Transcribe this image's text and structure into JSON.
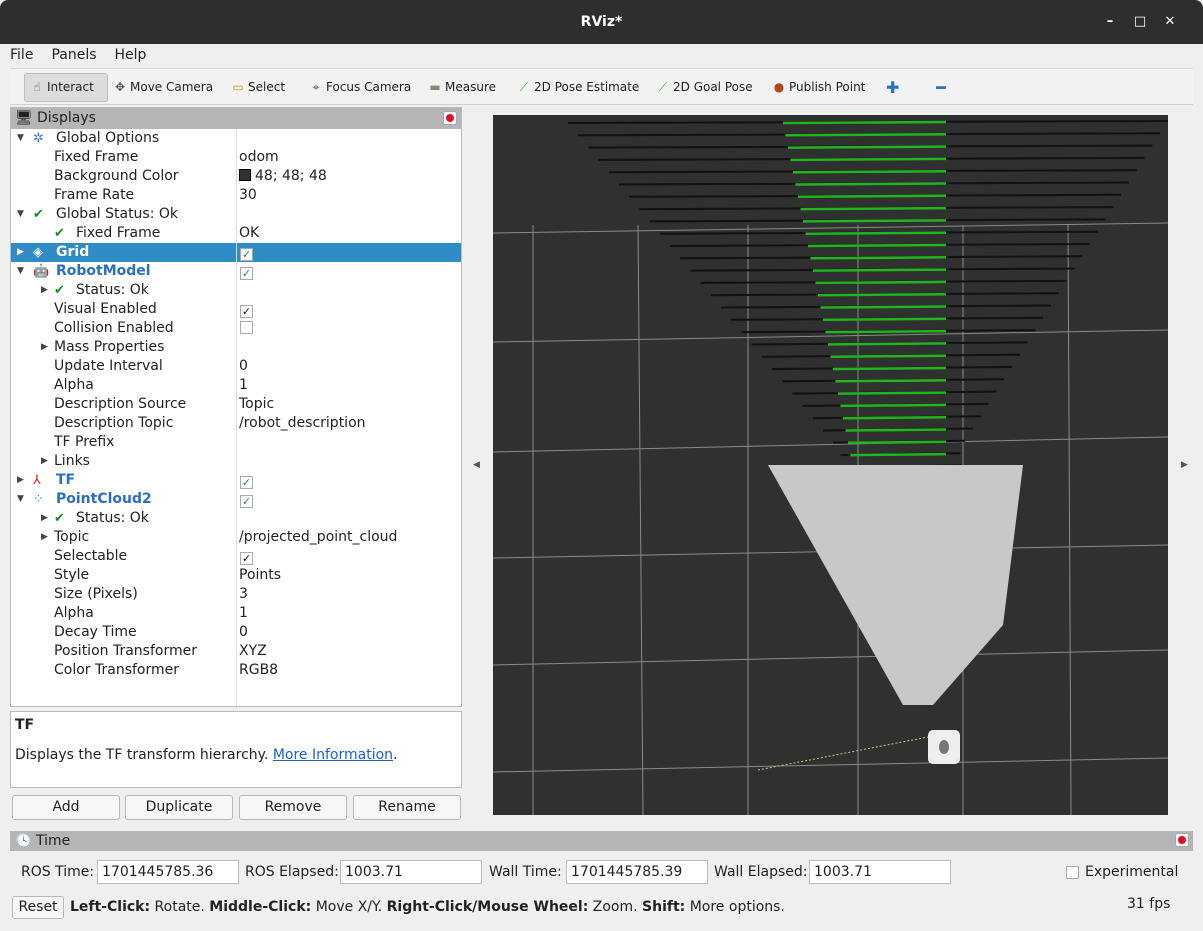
{
  "window": {
    "title": "RViz*"
  },
  "menu": [
    "File",
    "Panels",
    "Help"
  ],
  "toolbar": {
    "tools": [
      {
        "label": "Interact",
        "icon": "hand-icon",
        "active": true
      },
      {
        "label": "Move Camera",
        "icon": "move-camera-icon"
      },
      {
        "label": "Select",
        "icon": "select-icon"
      },
      {
        "label": "Focus Camera",
        "icon": "focus-camera-icon"
      },
      {
        "label": "Measure",
        "icon": "ruler-icon"
      },
      {
        "label": "2D Pose Estimate",
        "icon": "green-arrow-icon"
      },
      {
        "label": "2D Goal Pose",
        "icon": "green-arrow-icon"
      },
      {
        "label": "Publish Point",
        "icon": "map-pin-icon"
      }
    ]
  },
  "displays": {
    "title": "Displays",
    "rows": [
      {
        "label": "Global Options",
        "level": 0,
        "exp": "down",
        "icon": "gear-icon"
      },
      {
        "label": "Fixed Frame",
        "level": 1,
        "value": "odom"
      },
      {
        "label": "Background Color",
        "level": 1,
        "value": "48; 48; 48",
        "swatch": "#303030"
      },
      {
        "label": "Frame Rate",
        "level": 1,
        "value": "30"
      },
      {
        "label": "Global Status: Ok",
        "level": 0,
        "exp": "down",
        "icon": "check-icon"
      },
      {
        "label": "Fixed Frame",
        "level": 1,
        "value": "OK",
        "icon": "check-icon"
      },
      {
        "label": "Grid",
        "level": 0,
        "exp": "right",
        "icon": "grid-icon",
        "bold": true,
        "selected": true,
        "checked": true
      },
      {
        "label": "RobotModel",
        "level": 0,
        "exp": "down",
        "icon": "robot-icon",
        "bold": true,
        "checked": true
      },
      {
        "label": "Status: Ok",
        "level": 1,
        "exp": "right",
        "icon": "check-icon"
      },
      {
        "label": "Visual Enabled",
        "level": 1,
        "checked": true,
        "plain": true
      },
      {
        "label": "Collision Enabled",
        "level": 1,
        "checked": false
      },
      {
        "label": "Mass Properties",
        "level": 1,
        "exp": "right"
      },
      {
        "label": "Update Interval",
        "level": 1,
        "value": "0"
      },
      {
        "label": "Alpha",
        "level": 1,
        "value": "1"
      },
      {
        "label": "Description Source",
        "level": 1,
        "value": "Topic"
      },
      {
        "label": "Description Topic",
        "level": 1,
        "value": "/robot_description"
      },
      {
        "label": "TF Prefix",
        "level": 1
      },
      {
        "label": "Links",
        "level": 1,
        "exp": "right"
      },
      {
        "label": "TF",
        "level": 0,
        "exp": "right",
        "icon": "tf-axes-icon",
        "bold": true,
        "checked": true
      },
      {
        "label": "PointCloud2",
        "level": 0,
        "exp": "down",
        "icon": "pointcloud-icon",
        "bold": true,
        "checked": true
      },
      {
        "label": "Status: Ok",
        "level": 1,
        "exp": "right",
        "icon": "check-icon"
      },
      {
        "label": "Topic",
        "level": 1,
        "exp": "right",
        "value": "/projected_point_cloud"
      },
      {
        "label": "Selectable",
        "level": 1,
        "checked": true,
        "plain": true
      },
      {
        "label": "Style",
        "level": 1,
        "value": "Points"
      },
      {
        "label": "Size (Pixels)",
        "level": 1,
        "value": "3"
      },
      {
        "label": "Alpha",
        "level": 1,
        "value": "1"
      },
      {
        "label": "Decay Time",
        "level": 1,
        "value": "0"
      },
      {
        "label": "Position Transformer",
        "level": 1,
        "value": "XYZ"
      },
      {
        "label": "Color Transformer",
        "level": 1,
        "value": "RGB8"
      }
    ]
  },
  "description": {
    "title": "TF",
    "text": "Displays the TF transform hierarchy. ",
    "link": "More Information",
    "tail": "."
  },
  "buttons": {
    "add": "Add",
    "duplicate": "Duplicate",
    "remove": "Remove",
    "rename": "Rename"
  },
  "time": {
    "title": "Time",
    "ros_time_label": "ROS Time:",
    "ros_time": "1701445785.36",
    "ros_elapsed_label": "ROS Elapsed:",
    "ros_elapsed": "1003.71",
    "wall_time_label": "Wall Time:",
    "wall_time": "1701445785.39",
    "wall_elapsed_label": "Wall Elapsed:",
    "wall_elapsed": "1003.71",
    "experimental": "Experimental",
    "reset": "Reset"
  },
  "status": {
    "k1": "Left-Click:",
    "v1": " Rotate. ",
    "k2": "Middle-Click:",
    "v2": " Move X/Y. ",
    "k3": "Right-Click/Mouse Wheel:",
    "v3": " Zoom. ",
    "k4": "Shift:",
    "v4": " More options.",
    "fps": "31 fps"
  }
}
